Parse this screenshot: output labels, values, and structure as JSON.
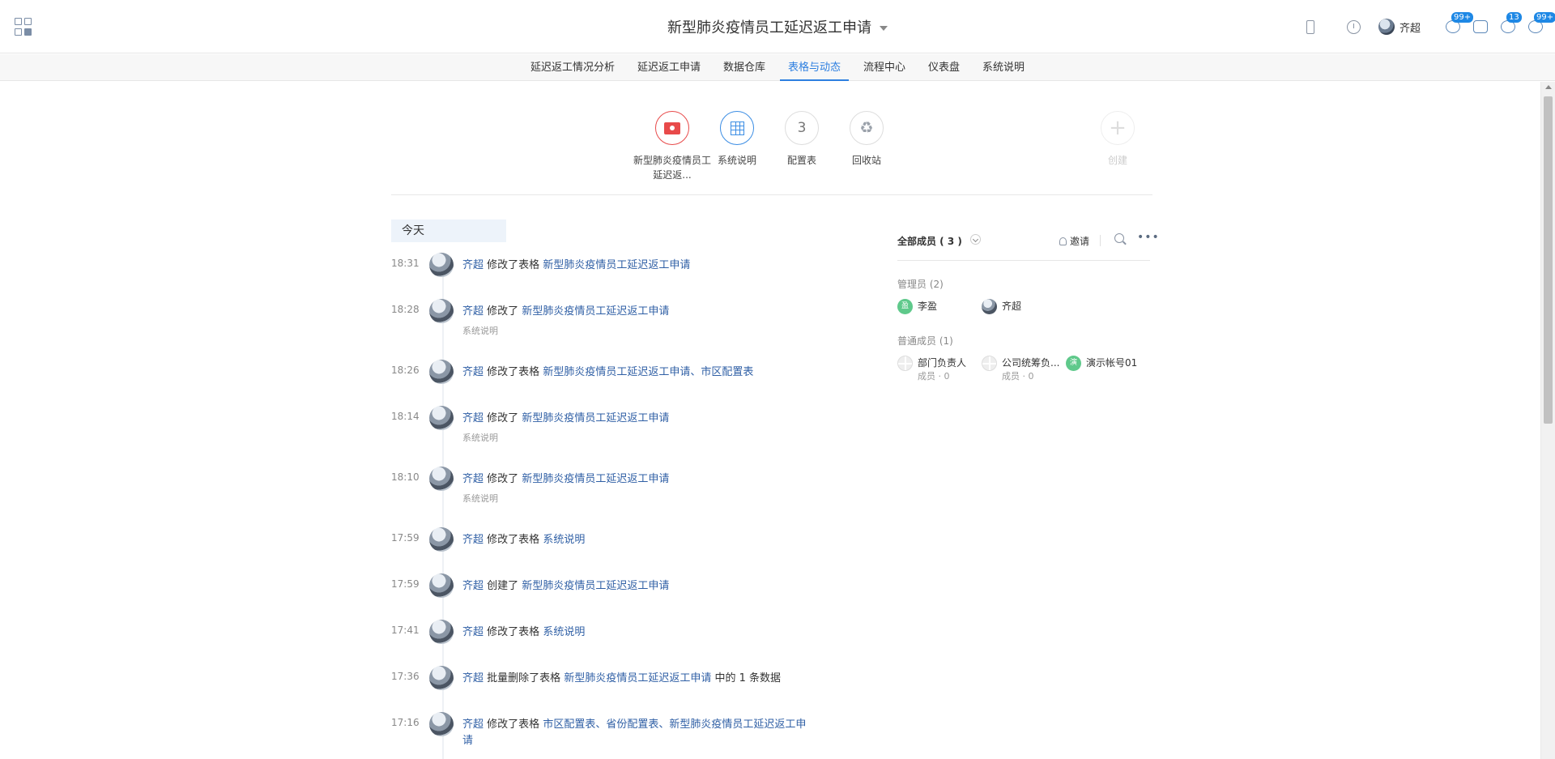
{
  "header": {
    "title": "新型肺炎疫情员工延迟返工申请",
    "user_name": "齐超",
    "badges": [
      "99+",
      "13",
      "99+"
    ]
  },
  "nav": {
    "tabs": [
      "延迟返工情况分析",
      "延迟返工申请",
      "数据仓库",
      "表格与动态",
      "流程中心",
      "仪表盘",
      "系统说明"
    ],
    "active": "表格与动态"
  },
  "tiles": [
    {
      "label": "新型肺炎疫情员工延迟返...",
      "icon": "folder-user-icon"
    },
    {
      "label": "系统说明",
      "icon": "table-icon"
    },
    {
      "label": "配置表",
      "icon": "number",
      "number": "3"
    },
    {
      "label": "回收站",
      "icon": "recycle-icon"
    },
    {
      "label": "创建",
      "icon": "plus-icon"
    }
  ],
  "timeline": {
    "day_label": "今天",
    "events": [
      {
        "time": "18:31",
        "user": "齐超",
        "action": "修改了表格",
        "target": "新型肺炎疫情员工延迟返工申请",
        "suffix": "",
        "sub": ""
      },
      {
        "time": "18:28",
        "user": "齐超",
        "action": "修改了",
        "target": "新型肺炎疫情员工延迟返工申请",
        "suffix": "",
        "sub": "系统说明"
      },
      {
        "time": "18:26",
        "user": "齐超",
        "action": "修改了表格",
        "target": "新型肺炎疫情员工延迟返工申请、市区配置表",
        "suffix": "",
        "sub": ""
      },
      {
        "time": "18:14",
        "user": "齐超",
        "action": "修改了",
        "target": "新型肺炎疫情员工延迟返工申请",
        "suffix": "",
        "sub": "系统说明"
      },
      {
        "time": "18:10",
        "user": "齐超",
        "action": "修改了",
        "target": "新型肺炎疫情员工延迟返工申请",
        "suffix": "",
        "sub": "系统说明"
      },
      {
        "time": "17:59",
        "user": "齐超",
        "action": "修改了表格",
        "target": "系统说明",
        "suffix": "",
        "sub": ""
      },
      {
        "time": "17:59",
        "user": "齐超",
        "action": "创建了",
        "target": "新型肺炎疫情员工延迟返工申请",
        "suffix": "",
        "sub": ""
      },
      {
        "time": "17:41",
        "user": "齐超",
        "action": "修改了表格",
        "target": "系统说明",
        "suffix": "",
        "sub": ""
      },
      {
        "time": "17:36",
        "user": "齐超",
        "action": "批量删除了表格",
        "target": "新型肺炎疫情员工延迟返工申请",
        "suffix": "中的 1 条数据",
        "sub": ""
      },
      {
        "time": "17:16",
        "user": "齐超",
        "action": "修改了表格",
        "target": "市区配置表、省份配置表、新型肺炎疫情员工延迟返工申请",
        "suffix": "",
        "sub": ""
      }
    ]
  },
  "members": {
    "title": "全部成员 ( 3 )",
    "invite_label": "邀请",
    "admin_group": "管理员 (2)",
    "admins": [
      {
        "name": "李盈",
        "avatar_text": "盈",
        "avatar": "green"
      },
      {
        "name": "齐超",
        "avatar_text": "",
        "avatar": "photo"
      }
    ],
    "normal_group": "普通成员 (1)",
    "normal": [
      {
        "name": "部门负责人",
        "sub": "成员 · 0",
        "avatar_text": "",
        "avatar": "gray"
      },
      {
        "name": "公司统筹负...",
        "sub": "成员 · 0",
        "avatar_text": "",
        "avatar": "gray"
      },
      {
        "name": "演示帐号01",
        "sub": "",
        "avatar_text": "演",
        "avatar": "green"
      }
    ]
  },
  "colors": {
    "accent": "#2d7fe0",
    "link": "#2f5fa5",
    "red": "#e84a4a"
  }
}
